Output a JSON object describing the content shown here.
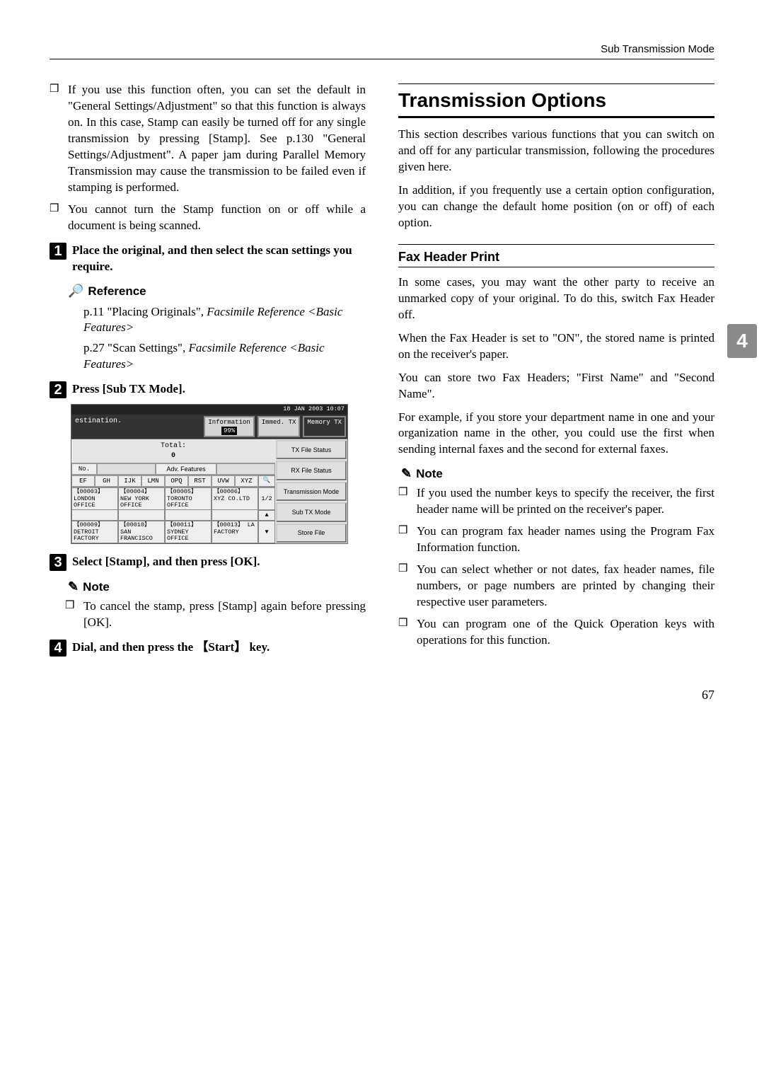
{
  "header": {
    "running": "Sub Transmission Mode"
  },
  "side_tab": "4",
  "page_number": "67",
  "left": {
    "bullets_top": [
      "If you use this function often, you can set the default in \"General Settings/Adjustment\" so that this function is always on. In this case, Stamp can easily be turned off for any single transmission by pressing [Stamp]. See p.130 \"General Settings/Adjustment\".  A paper jam during Parallel Memory Transmission may cause the transmission to be failed even if stamping is performed.",
      "You cannot turn the Stamp function on or off while a document is being scanned."
    ],
    "steps": {
      "s1": "Place the original, and then select the scan settings you require.",
      "s2": "Press [Sub TX Mode].",
      "s3": "Select [Stamp], and then press [OK].",
      "s4": "Dial, and then press the 【Start】 key."
    },
    "reference_label": "Reference",
    "reference_body": {
      "r1_a": "p.11 \"Placing Originals\", ",
      "r1_b": "Facsimile Reference <Basic Features>",
      "r2_a": "p.27 \"Scan Settings\", ",
      "r2_b": "Facsimile Reference <Basic Features>"
    },
    "note_label": "Note",
    "note_bullets": [
      "To cancel the stamp, press [Stamp] again before pressing [OK]."
    ],
    "lcd": {
      "timestamp": "18 JAN 2003 10:07",
      "dest": "estination.",
      "info_label": "Information",
      "pct": "99%",
      "immed": "Immed. TX",
      "memory": "Memory TX",
      "total_label": "Total:",
      "total_value": "0",
      "adv": "Adv. Features",
      "no": "No.",
      "side_buttons": [
        "TX File Status",
        "RX File Status",
        "Transmission Mode",
        "Sub TX Mode",
        "Store File"
      ],
      "alpha": [
        "EF",
        "GH",
        "IJK",
        "LMN",
        "OPQ",
        "RST",
        "UVW",
        "XYZ"
      ],
      "page_indicator": "1/2",
      "cells_row1": [
        "【00003】 LONDON OFFICE",
        "【00004】 NEW YORK OFFICE",
        "【00005】 TORONTO OFFICE",
        "【00006】 XYZ CO.LTD"
      ],
      "cells_row2": [
        "【00009】 DETROIT FACTORY",
        "【00010】 SAN FRANCISCO",
        "【00011】 SYDNEY OFFICE",
        "【00013】 LA FACTORY"
      ]
    }
  },
  "right": {
    "h2": "Transmission Options",
    "intro1": "This section describes various functions that you can switch on and off for any particular transmission, following the procedures given here.",
    "intro2": "In addition, if you frequently use a certain option configuration, you can change the default home position (on or off) of each option.",
    "h3": "Fax Header Print",
    "fh1": "In some cases, you may want the other party to receive an unmarked copy of your original. To do this, switch Fax Header off.",
    "fh2": "When the Fax Header is set to \"ON\", the stored name is printed on the receiver's paper.",
    "fh3": "You can store two Fax Headers; \"First Name\" and \"Second Name\".",
    "fh4": "For example, if you store your department name in one and your organization name in the other, you could use the first when sending internal faxes and the second for external faxes.",
    "note_label": "Note",
    "note_bullets": [
      "If you used the number keys to specify the receiver, the first header name will be printed on the receiver's paper.",
      "You can program fax header names using the Program Fax Information function.",
      "You can select whether or not dates, fax header names, file numbers, or page numbers are printed by changing their respective user parameters.",
      "You can program one of the Quick Operation keys with operations for this function."
    ]
  }
}
